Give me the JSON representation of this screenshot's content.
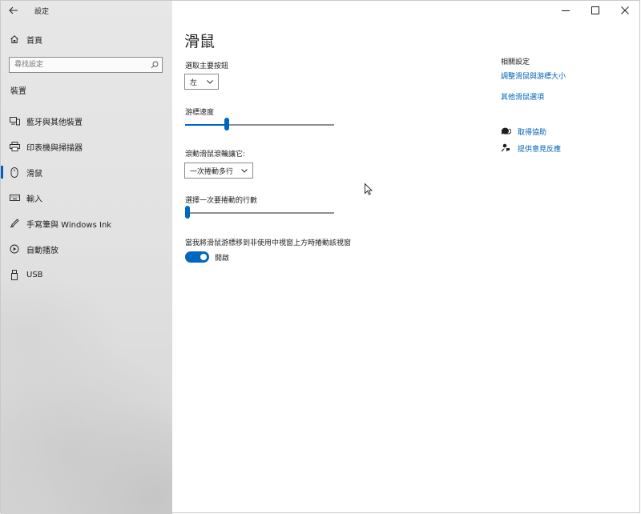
{
  "window": {
    "title": "設定"
  },
  "sidebar": {
    "home_label": "首頁",
    "search_placeholder": "尋找設定",
    "section_header": "裝置",
    "items": [
      {
        "label": "藍牙與其他裝置",
        "icon": "bluetooth-devices-icon"
      },
      {
        "label": "印表機與掃描器",
        "icon": "printer-icon"
      },
      {
        "label": "滑鼠",
        "icon": "mouse-icon",
        "selected": true
      },
      {
        "label": "輸入",
        "icon": "keyboard-icon"
      },
      {
        "label": "手寫筆與 Windows Ink",
        "icon": "pen-icon"
      },
      {
        "label": "自動播放",
        "icon": "autoplay-icon"
      },
      {
        "label": "USB",
        "icon": "usb-icon"
      }
    ]
  },
  "main": {
    "title": "滑鼠",
    "primary_button": {
      "label": "選取主要按鈕",
      "value": "左"
    },
    "cursor_speed": {
      "label": "游標速度",
      "level": 0.27
    },
    "wheel_scroll": {
      "label": "滾動滑鼠滾輪讓它:",
      "value": "一次捲動多行"
    },
    "lines_to_scroll": {
      "label": "選擇一次要捲動的行數",
      "level": 0.0
    },
    "inactive_scroll": {
      "label": "當我將滑鼠游標移到非使用中視窗上方時捲動該視窗",
      "state_label": "開啟",
      "on": true
    }
  },
  "related": {
    "title": "相關設定",
    "links": [
      "調整滑鼠與游標大小",
      "其他滑鼠選項"
    ],
    "help_links": [
      {
        "label": "取得協助",
        "icon": "get-help-icon"
      },
      {
        "label": "提供意見反應",
        "icon": "feedback-icon"
      }
    ]
  },
  "colors": {
    "accent": "#0067c0",
    "link": "#005fb8"
  }
}
